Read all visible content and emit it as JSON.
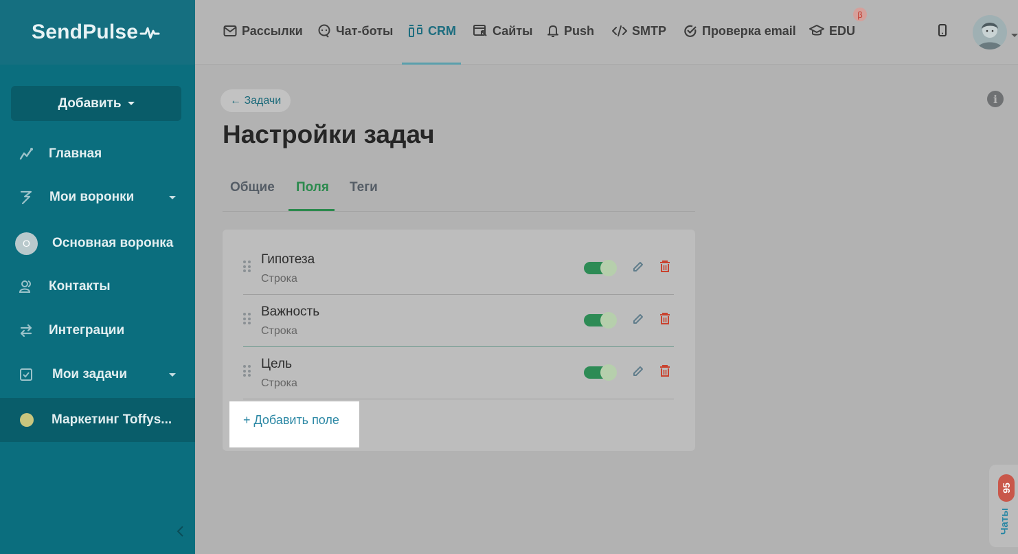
{
  "brand": {
    "name": "SendPulse"
  },
  "sidebar": {
    "add_label": "Добавить",
    "items": [
      {
        "label": "Главная",
        "icon": "chart-line-icon"
      },
      {
        "label": "Мои воронки",
        "icon": "funnel-icon",
        "expandable": true
      },
      {
        "label": "Основная воронка",
        "avatar": "О"
      },
      {
        "label": "Контакты",
        "icon": "contacts-icon"
      },
      {
        "label": "Интеграции",
        "icon": "arrows-exchange-icon"
      },
      {
        "label": "Мои задачи",
        "icon": "checkbox-icon",
        "expandable": true
      },
      {
        "label": "Маркетинг Toffys..."
      }
    ]
  },
  "topnav": {
    "items": [
      {
        "label": "Рассылки",
        "icon": "mail-icon"
      },
      {
        "label": "Чат-боты",
        "icon": "chat-bot-icon"
      },
      {
        "label": "CRM",
        "icon": "crm-icon",
        "active": true
      },
      {
        "label": "Сайты",
        "icon": "site-icon"
      },
      {
        "label": "Push",
        "icon": "bell-icon"
      },
      {
        "label": "SMTP",
        "icon": "code-icon"
      },
      {
        "label": "Проверка email",
        "icon": "check-circle-icon"
      },
      {
        "label": "EDU",
        "icon": "graduation-cap-icon"
      }
    ],
    "beta_badge": "β"
  },
  "page": {
    "back_link": "← Задачи",
    "title": "Настройки задач",
    "tabs": [
      {
        "label": "Общие"
      },
      {
        "label": "Поля",
        "active": true
      },
      {
        "label": "Теги"
      }
    ],
    "fields": [
      {
        "name": "Гипотеза",
        "type": "Строка",
        "enabled": true
      },
      {
        "name": "Важность",
        "type": "Строка",
        "enabled": true
      },
      {
        "name": "Цель",
        "type": "Строка",
        "enabled": true
      }
    ],
    "add_field_label": "+ Добавить поле",
    "info_glyph": "i"
  },
  "chats": {
    "label": "Чаты",
    "count": "95"
  },
  "colors": {
    "sidebar": "#0b6e7e",
    "accent_green": "#2b8a4d",
    "delete_red": "#c9432f",
    "link_blue": "#2a87a4"
  }
}
